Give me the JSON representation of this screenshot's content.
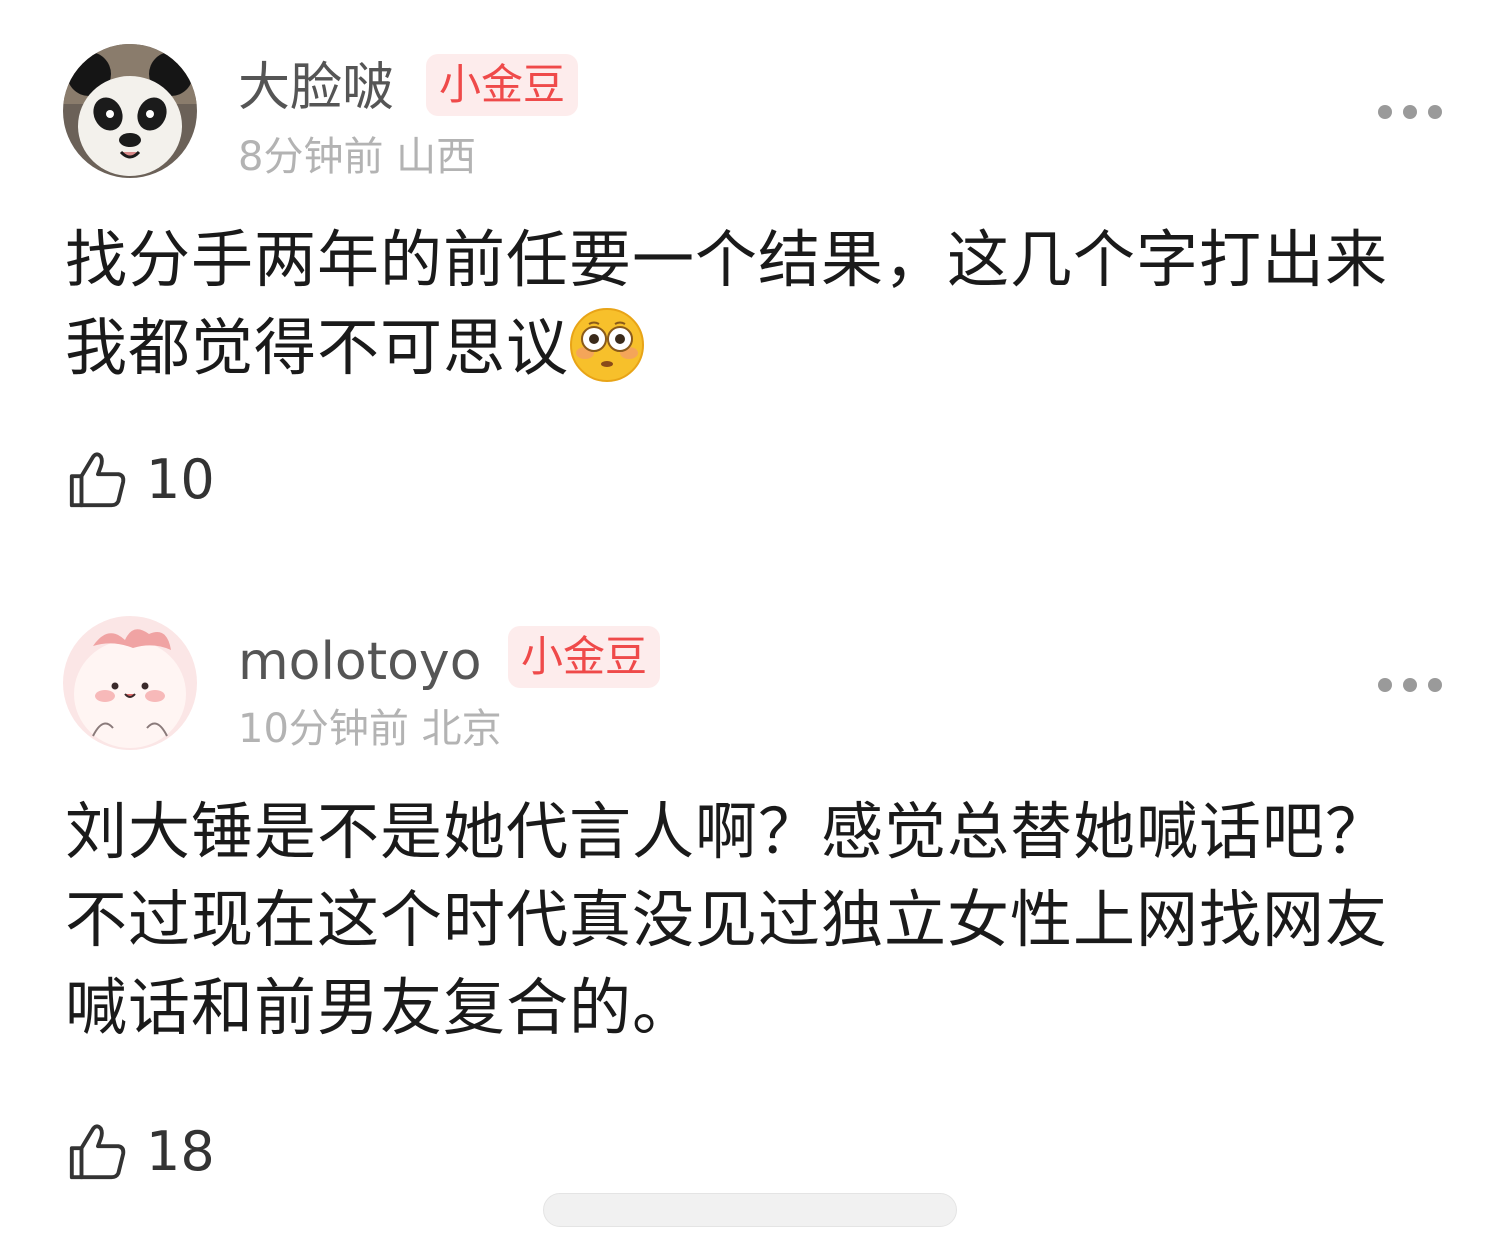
{
  "comments": [
    {
      "username": "大脸啵",
      "badge": "小金豆",
      "meta": "8分钟前 山西",
      "text": "找分手两年的前任要一个结果，这几个字打出来我都觉得不可思议",
      "likes": "10",
      "avatar_icon": "panda-avatar",
      "trailing_emoji": "flushed-face-emoji"
    },
    {
      "username": "molotoyo",
      "badge": "小金豆",
      "meta": "10分钟前 北京",
      "text": "刘大锤是不是她代言人啊？感觉总替她喊话吧？不过现在这个时代真没见过独立女性上网找网友喊话和前男友复合的。",
      "likes": "18",
      "avatar_icon": "pink-cartoon-avatar"
    }
  ],
  "colors": {
    "badge_bg": "#fdecec",
    "badge_text": "#ef4a4a",
    "username": "#555555",
    "meta": "#b3b3b3",
    "body": "#1a1a1a"
  }
}
